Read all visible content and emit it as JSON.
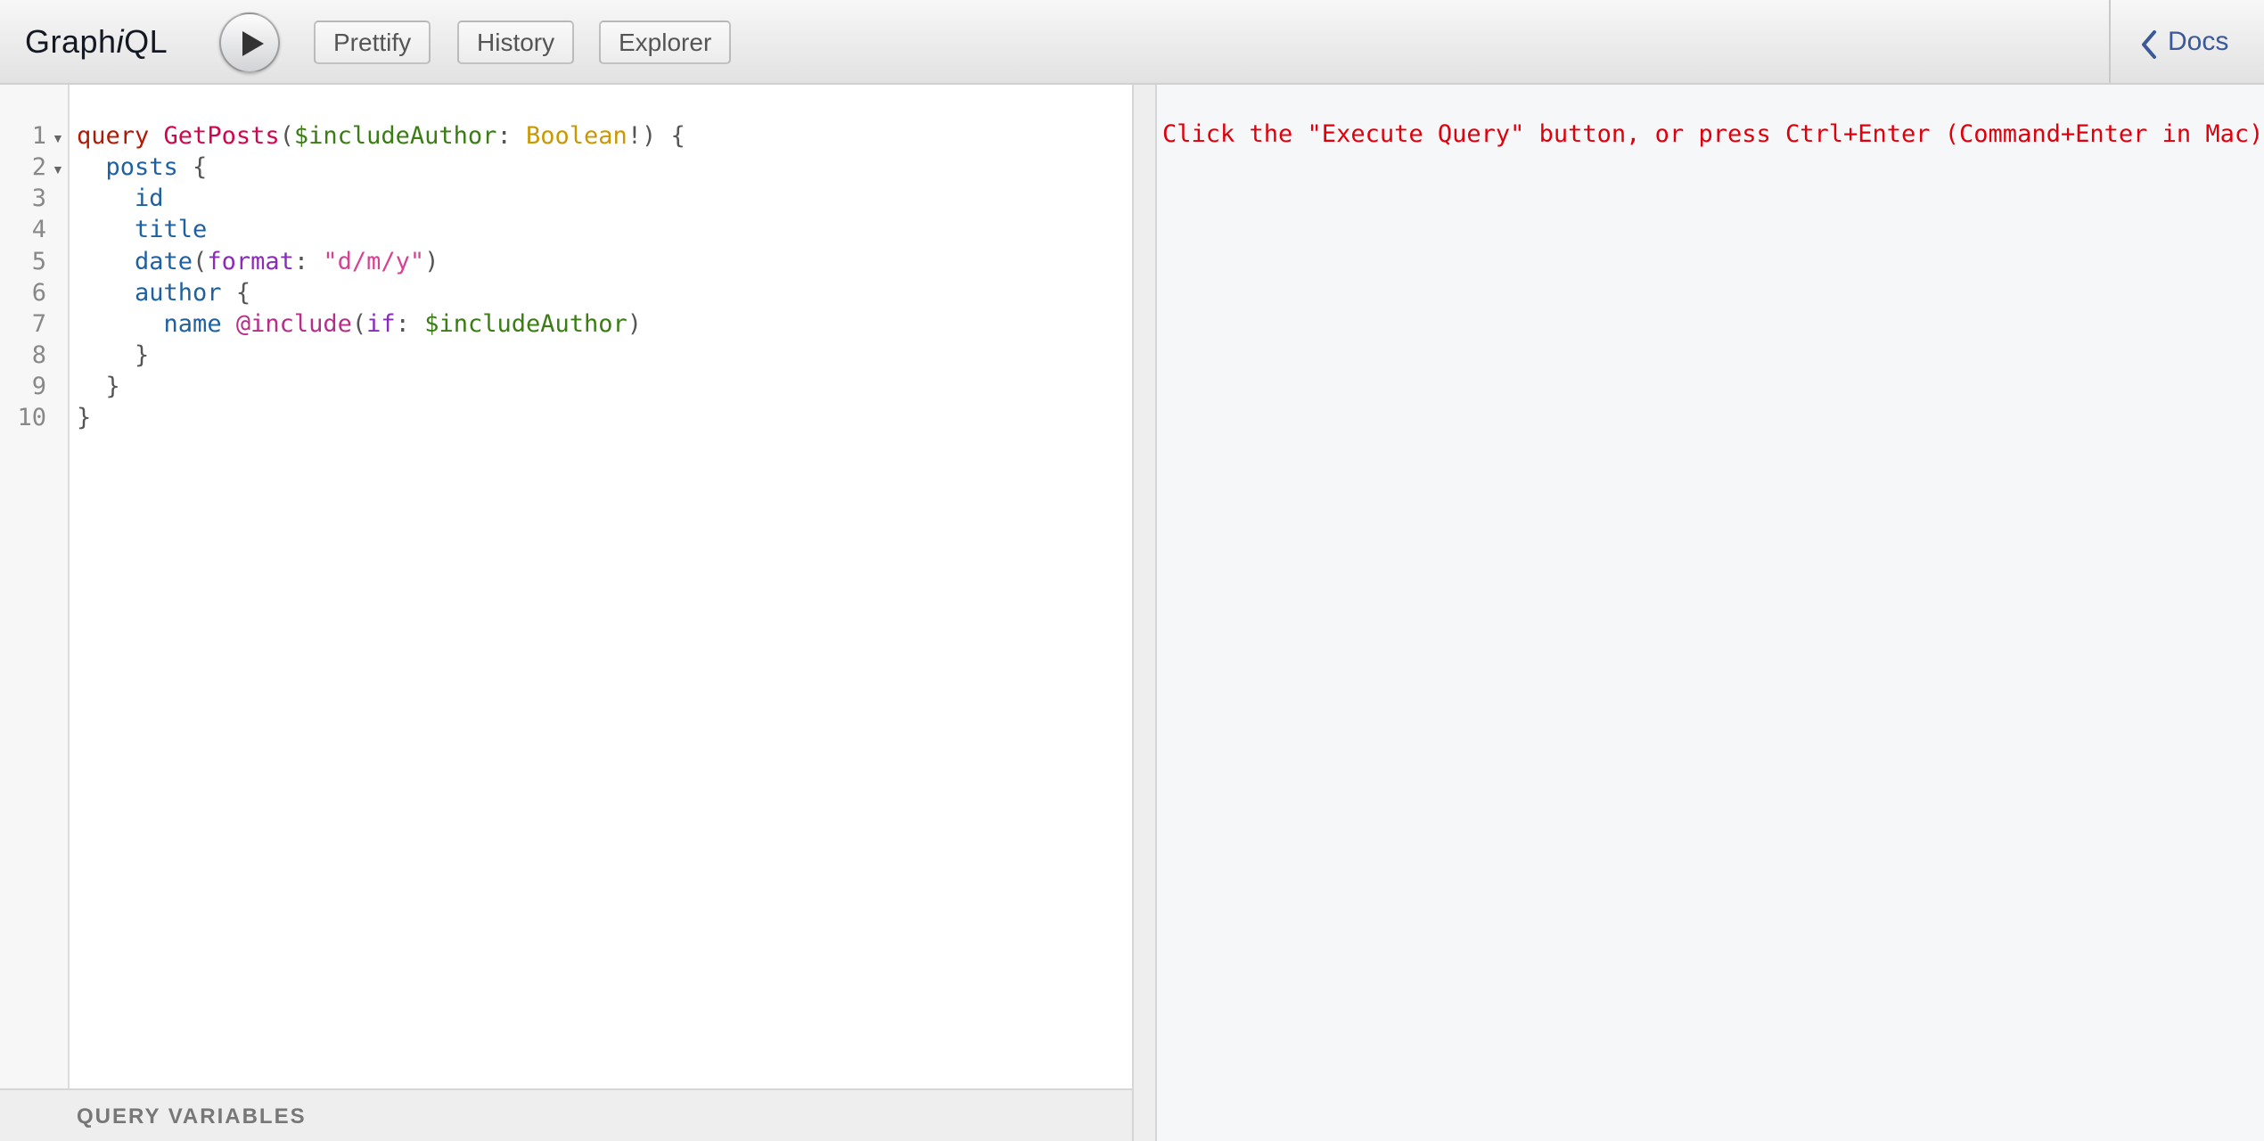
{
  "app": {
    "title_prefix": "Graph",
    "title_italic": "i",
    "title_suffix": "QL"
  },
  "toolbar": {
    "prettify_label": "Prettify",
    "history_label": "History",
    "explorer_label": "Explorer",
    "docs_label": "Docs"
  },
  "editor": {
    "line_numbers": [
      "1",
      "2",
      "3",
      "4",
      "5",
      "6",
      "7",
      "8",
      "9",
      "10"
    ],
    "lines": {
      "l1": {
        "kw": "query",
        "name": "GetPosts",
        "p1": "(",
        "var": "$includeAuthor",
        "colon": ": ",
        "type": "Boolean",
        "p2": "!) {"
      },
      "l2": {
        "indent": "  ",
        "field": "posts",
        "p": " {"
      },
      "l3": {
        "indent": "    ",
        "field": "id"
      },
      "l4": {
        "indent": "    ",
        "field": "title"
      },
      "l5": {
        "indent": "    ",
        "field": "date",
        "p1": "(",
        "arg": "format",
        "colon": ": ",
        "str": "\"d/m/y\"",
        "p2": ")"
      },
      "l6": {
        "indent": "    ",
        "field": "author",
        "p": " {"
      },
      "l7": {
        "indent": "      ",
        "field": "name",
        "sp": " ",
        "dir": "@include",
        "p1": "(",
        "arg": "if",
        "colon": ": ",
        "var": "$includeAuthor",
        "p2": ")"
      },
      "l8": {
        "text": "    }"
      },
      "l9": {
        "text": "  }"
      },
      "l10": {
        "text": "}"
      }
    }
  },
  "variables": {
    "title": "QUERY VARIABLES"
  },
  "result": {
    "hint": "Click the \"Execute Query\" button, or press Ctrl+Enter (Command+Enter in Mac)"
  },
  "icons": {
    "execute": "play-icon",
    "docs": "chevron-left-icon",
    "fold": "fold-arrow-icon"
  },
  "colors": {
    "keyword": "#b11a04",
    "def": "#d2054e",
    "variable": "#397d13",
    "type": "#ca9800",
    "property": "#1f61a0",
    "argument": "#8b2bb9",
    "string": "#d64292",
    "directive": "#b33086",
    "result_hint": "#e0000c"
  }
}
